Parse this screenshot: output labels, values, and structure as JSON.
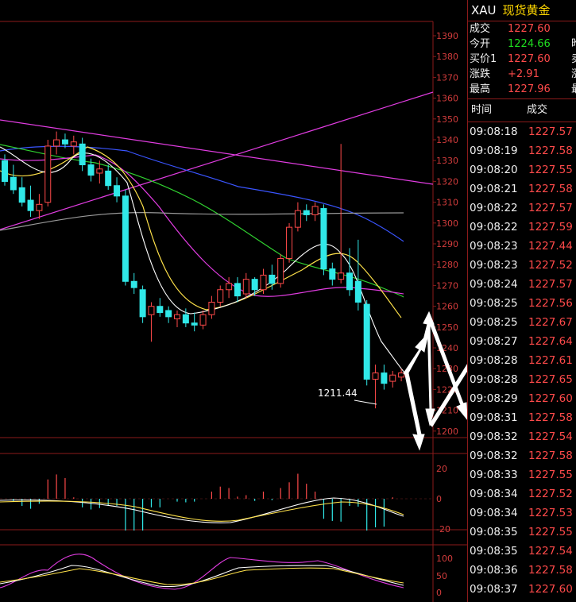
{
  "colors": {
    "up": "#ff4a4a",
    "down": "#30e8e8",
    "frame": "#8b1a1a",
    "accent_name": "#ffd700",
    "quote_green": "#1fdc1f"
  },
  "header": {
    "symbol": "XAU",
    "name": "现货黄金"
  },
  "quote": [
    {
      "label": "成交",
      "value": "1227.60",
      "color": "red",
      "cut": ""
    },
    {
      "label": "今开",
      "value": "1224.66",
      "color": "green",
      "cut": "昨"
    },
    {
      "label": "买价1",
      "value": "1227.60",
      "color": "red",
      "cut": "卖"
    },
    {
      "label": "涨跌",
      "value": "+2.91",
      "color": "red",
      "cut": "涨"
    },
    {
      "label": "最高",
      "value": "1227.96",
      "color": "red",
      "cut": "最"
    }
  ],
  "ticks_header": {
    "time": "时间",
    "price": "成交"
  },
  "ticks": [
    {
      "time": "09:08:18",
      "price": "1227.57"
    },
    {
      "time": "09:08:19",
      "price": "1227.58"
    },
    {
      "time": "09:08:20",
      "price": "1227.55"
    },
    {
      "time": "09:08:21",
      "price": "1227.58"
    },
    {
      "time": "09:08:22",
      "price": "1227.57"
    },
    {
      "time": "09:08:22",
      "price": "1227.59"
    },
    {
      "time": "09:08:23",
      "price": "1227.44"
    },
    {
      "time": "09:08:23",
      "price": "1227.52"
    },
    {
      "time": "09:08:24",
      "price": "1227.57"
    },
    {
      "time": "09:08:25",
      "price": "1227.56"
    },
    {
      "time": "09:08:25",
      "price": "1227.67"
    },
    {
      "time": "09:08:27",
      "price": "1227.64"
    },
    {
      "time": "09:08:28",
      "price": "1227.61"
    },
    {
      "time": "09:08:28",
      "price": "1227.65"
    },
    {
      "time": "09:08:29",
      "price": "1227.60"
    },
    {
      "time": "09:08:31",
      "price": "1227.58"
    },
    {
      "time": "09:08:32",
      "price": "1227.54"
    },
    {
      "time": "09:08:32",
      "price": "1227.58"
    },
    {
      "time": "09:08:33",
      "price": "1227.55"
    },
    {
      "time": "09:08:34",
      "price": "1227.52"
    },
    {
      "time": "09:08:34",
      "price": "1227.53"
    },
    {
      "time": "09:08:35",
      "price": "1227.55"
    },
    {
      "time": "09:08:35",
      "price": "1227.54"
    },
    {
      "time": "09:08:36",
      "price": "1227.58"
    },
    {
      "time": "09:08:37",
      "price": "1227.60"
    }
  ],
  "chart_data": {
    "type": "candlestick",
    "price_ticks": [
      "1390",
      "1380",
      "1370",
      "1360",
      "1350",
      "1340",
      "1330",
      "1320",
      "1310",
      "1300",
      "1290",
      "1280",
      "1270",
      "1260",
      "1250",
      "1240",
      "1230",
      "1220",
      "1210",
      "1200"
    ],
    "price_range": [
      1196,
      1394
    ],
    "low_annotation": "1211.44",
    "macd_ticks": [
      "20",
      "0",
      "-20"
    ],
    "kdj_ticks": [
      "100",
      "50",
      "0"
    ],
    "candles": [
      {
        "o": 1330,
        "h": 1333,
        "l": 1318,
        "c": 1320
      },
      {
        "o": 1322,
        "h": 1328,
        "l": 1314,
        "c": 1316
      },
      {
        "o": 1317,
        "h": 1322,
        "l": 1308,
        "c": 1310
      },
      {
        "o": 1311,
        "h": 1318,
        "l": 1303,
        "c": 1306
      },
      {
        "o": 1306,
        "h": 1314,
        "l": 1302,
        "c": 1309
      },
      {
        "o": 1310,
        "h": 1340,
        "l": 1308,
        "c": 1337
      },
      {
        "o": 1337,
        "h": 1344,
        "l": 1333,
        "c": 1340
      },
      {
        "o": 1340,
        "h": 1343,
        "l": 1336,
        "c": 1338
      },
      {
        "o": 1337,
        "h": 1342,
        "l": 1333,
        "c": 1339
      },
      {
        "o": 1338,
        "h": 1341,
        "l": 1325,
        "c": 1328
      },
      {
        "o": 1328,
        "h": 1331,
        "l": 1320,
        "c": 1323
      },
      {
        "o": 1324,
        "h": 1330,
        "l": 1319,
        "c": 1326
      },
      {
        "o": 1325,
        "h": 1328,
        "l": 1316,
        "c": 1318
      },
      {
        "o": 1318,
        "h": 1322,
        "l": 1310,
        "c": 1313
      },
      {
        "o": 1313,
        "h": 1316,
        "l": 1270,
        "c": 1272
      },
      {
        "o": 1272,
        "h": 1276,
        "l": 1266,
        "c": 1269
      },
      {
        "o": 1268,
        "h": 1270,
        "l": 1252,
        "c": 1255
      },
      {
        "o": 1256,
        "h": 1262,
        "l": 1243,
        "c": 1260
      },
      {
        "o": 1260,
        "h": 1264,
        "l": 1255,
        "c": 1257
      },
      {
        "o": 1258,
        "h": 1260,
        "l": 1252,
        "c": 1255
      },
      {
        "o": 1254,
        "h": 1258,
        "l": 1250,
        "c": 1256
      },
      {
        "o": 1256,
        "h": 1259,
        "l": 1250,
        "c": 1252
      },
      {
        "o": 1252,
        "h": 1257,
        "l": 1248,
        "c": 1251
      },
      {
        "o": 1251,
        "h": 1258,
        "l": 1249,
        "c": 1256
      },
      {
        "o": 1256,
        "h": 1265,
        "l": 1254,
        "c": 1262
      },
      {
        "o": 1262,
        "h": 1270,
        "l": 1260,
        "c": 1268
      },
      {
        "o": 1268,
        "h": 1274,
        "l": 1264,
        "c": 1271
      },
      {
        "o": 1271,
        "h": 1274,
        "l": 1262,
        "c": 1265
      },
      {
        "o": 1266,
        "h": 1276,
        "l": 1264,
        "c": 1273
      },
      {
        "o": 1273,
        "h": 1274,
        "l": 1265,
        "c": 1268
      },
      {
        "o": 1268,
        "h": 1278,
        "l": 1266,
        "c": 1275
      },
      {
        "o": 1275,
        "h": 1280,
        "l": 1268,
        "c": 1271
      },
      {
        "o": 1271,
        "h": 1285,
        "l": 1269,
        "c": 1283
      },
      {
        "o": 1283,
        "h": 1300,
        "l": 1281,
        "c": 1298
      },
      {
        "o": 1298,
        "h": 1310,
        "l": 1296,
        "c": 1306
      },
      {
        "o": 1306,
        "h": 1309,
        "l": 1301,
        "c": 1304
      },
      {
        "o": 1304,
        "h": 1310,
        "l": 1301,
        "c": 1308
      },
      {
        "o": 1307,
        "h": 1309,
        "l": 1275,
        "c": 1278
      },
      {
        "o": 1278,
        "h": 1281,
        "l": 1270,
        "c": 1273
      },
      {
        "o": 1273,
        "h": 1338,
        "l": 1271,
        "c": 1276
      },
      {
        "o": 1276,
        "h": 1288,
        "l": 1265,
        "c": 1268
      },
      {
        "o": 1272,
        "h": 1292,
        "l": 1258,
        "c": 1262
      },
      {
        "o": 1261,
        "h": 1263,
        "l": 1222,
        "c": 1225
      },
      {
        "o": 1225,
        "h": 1232,
        "l": 1211,
        "c": 1228
      },
      {
        "o": 1228,
        "h": 1232,
        "l": 1220,
        "c": 1223
      },
      {
        "o": 1224,
        "h": 1229,
        "l": 1221,
        "c": 1227
      },
      {
        "o": 1226,
        "h": 1230,
        "l": 1224,
        "c": 1228
      }
    ]
  }
}
